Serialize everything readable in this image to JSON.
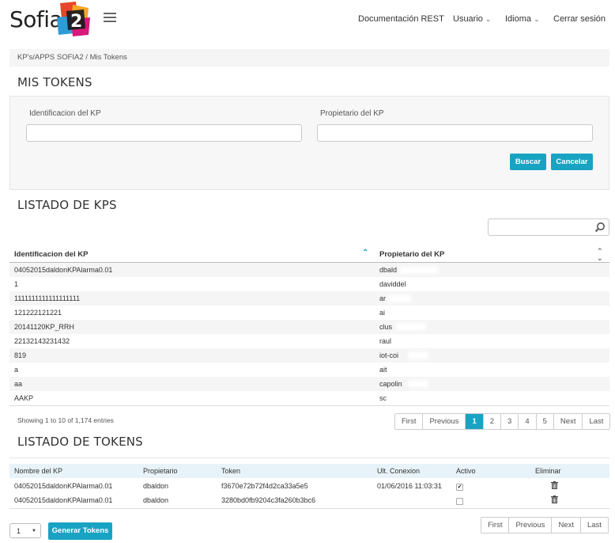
{
  "header": {
    "brand": "Sofia",
    "brand_number": "2",
    "nav": {
      "rest_docs": "Documentación REST",
      "user": "Usuario",
      "language": "Idioma",
      "logout": "Cerrar sesión"
    }
  },
  "breadcrumb": "KP's/APPS SOFIA2 / Mis Tokens",
  "page_title": "MIS TOKENS",
  "filter": {
    "kp_label": "Identificacion del KP",
    "kp_value": "",
    "owner_label": "Propietario del KP",
    "owner_value": "",
    "search_button": "Buscar",
    "cancel_button": "Cancelar"
  },
  "kp_list": {
    "title": "LISTADO DE KPS",
    "search_value": "",
    "columns": [
      "Identificacion del KP",
      "Propietario del KP"
    ],
    "rows": [
      {
        "id": "04052015daldonKPAlarma0.01",
        "owner": "dbald"
      },
      {
        "id": "1",
        "owner": "daviddel"
      },
      {
        "id": "1111111111111111111",
        "owner": "ar"
      },
      {
        "id": "121222121221",
        "owner": "ai"
      },
      {
        "id": "20141120KP_RRH",
        "owner": "clus"
      },
      {
        "id": "22132143231432",
        "owner": "raul"
      },
      {
        "id": "819",
        "owner": "iot-coi"
      },
      {
        "id": "a",
        "owner": "ait"
      },
      {
        "id": "aa",
        "owner": "capolin"
      },
      {
        "id": "AAKP",
        "owner": "sc"
      }
    ],
    "info": "Showing 1 to 10 of 1,174 entries",
    "pager": [
      "First",
      "Previous",
      "1",
      "2",
      "3",
      "4",
      "5",
      "Next",
      "Last"
    ],
    "current_page": "1"
  },
  "tokens": {
    "title": "LISTADO DE TOKENS",
    "columns": [
      "Nombre del KP",
      "Propietario",
      "Token",
      "Ult. Conexion",
      "Activo",
      "Eliminar"
    ],
    "rows": [
      {
        "kp": "04052015daldonKPAlarma0.01",
        "owner": "dbaldon",
        "token": "f3670e72b72f4d2ca33a5e5",
        "last_connection": "01/06/2016 11:03:31",
        "active": "✔"
      },
      {
        "kp": "04052015daldonKPAlarma0.01",
        "owner": "dbaldon",
        "token": "3280bd0fb9204c3fa260b3bc6",
        "last_connection": "",
        "active": ""
      }
    ],
    "pager": [
      "First",
      "Previous",
      "Next",
      "Last"
    ],
    "count_select": "1",
    "generate_button": "Generar Tokens"
  },
  "colors": {
    "accent": "#19a3c3",
    "table_header_bg": "#e7f3f8",
    "stripe": "#f5f5f5"
  }
}
